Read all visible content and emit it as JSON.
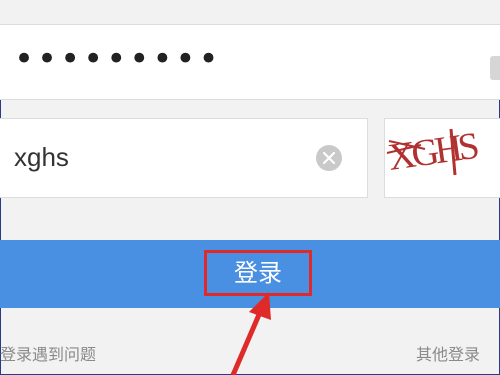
{
  "password_field": {
    "value": "•••••••••"
  },
  "captcha_field": {
    "value": "xghs"
  },
  "captcha_image": {
    "text": "XGHS"
  },
  "login_button": {
    "label": "登录"
  },
  "footer": {
    "left_link": "登录遇到问题",
    "right_link": "其他登录"
  },
  "colors": {
    "accent": "#4a90e2",
    "annotation": "#e02a2a"
  },
  "icons": {
    "clear": "clear-icon",
    "arrow": "annotation-arrow"
  }
}
